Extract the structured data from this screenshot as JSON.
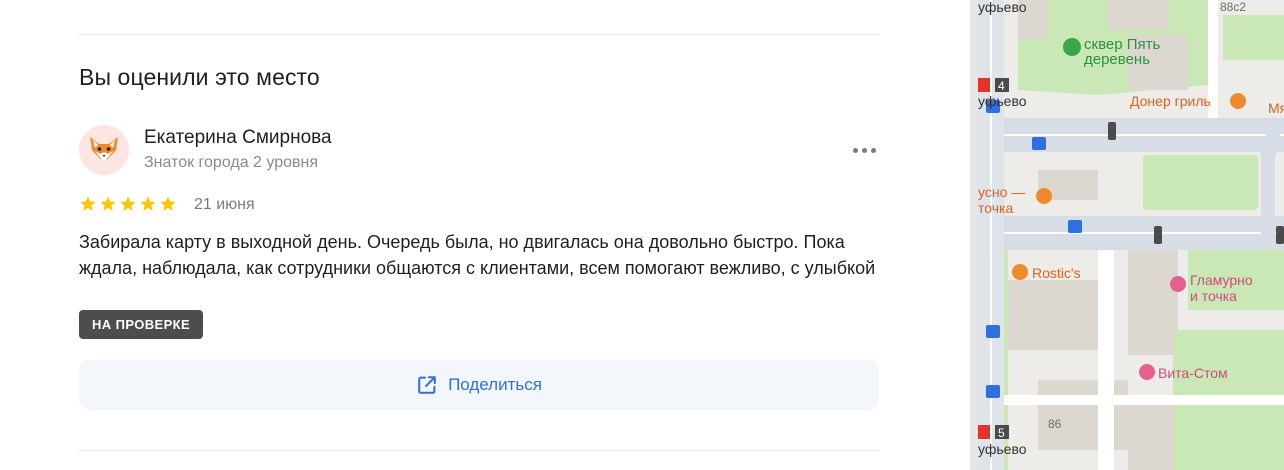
{
  "review_section": {
    "title": "Вы оценили это место",
    "author": {
      "name": "Екатерина Смирнова",
      "level": "Знаток города 2 уровня",
      "avatar_icon": "fox-avatar-icon"
    },
    "rating": 5,
    "rating_max": 5,
    "date": "21 июня",
    "text": "Забирала карту в выходной день. Очередь была, но двигалась она довольно быстро. Пока ждала, наблюдала, как сотрудники общаются с клиентами, всем помогают вежливо, с улыбкой",
    "status": "НА ПРОВЕРКЕ",
    "share_label": "Поделиться",
    "more_icon": "more-dots-icon",
    "share_icon": "external-share-icon",
    "colors": {
      "star": "#fcc600",
      "share_text": "#2f6fe0",
      "badge_bg": "#4d4d4d",
      "share_bg": "#f3f6fb"
    }
  },
  "map": {
    "labels": {
      "metro_top": "уфьево",
      "metro_mid": "уфьево",
      "metro_bottom": "уфьево",
      "metro_line_top": "4",
      "metro_line_bottom": "5",
      "square": "сквер Пять\nдеревень",
      "doner": "Донер гриль",
      "right_edge": "Мя",
      "vkusno": "усно —\nточка",
      "rostics": "Rostic's",
      "glamurno": "Гламурно\nи точка",
      "vitastom": "Вита-Стом",
      "house_86": "86",
      "house_88c2": "88с2"
    },
    "colors": {
      "road": "#ffffff",
      "green": "#c9e8b5",
      "building": "#ddd8cf",
      "background": "#eeece8"
    }
  }
}
